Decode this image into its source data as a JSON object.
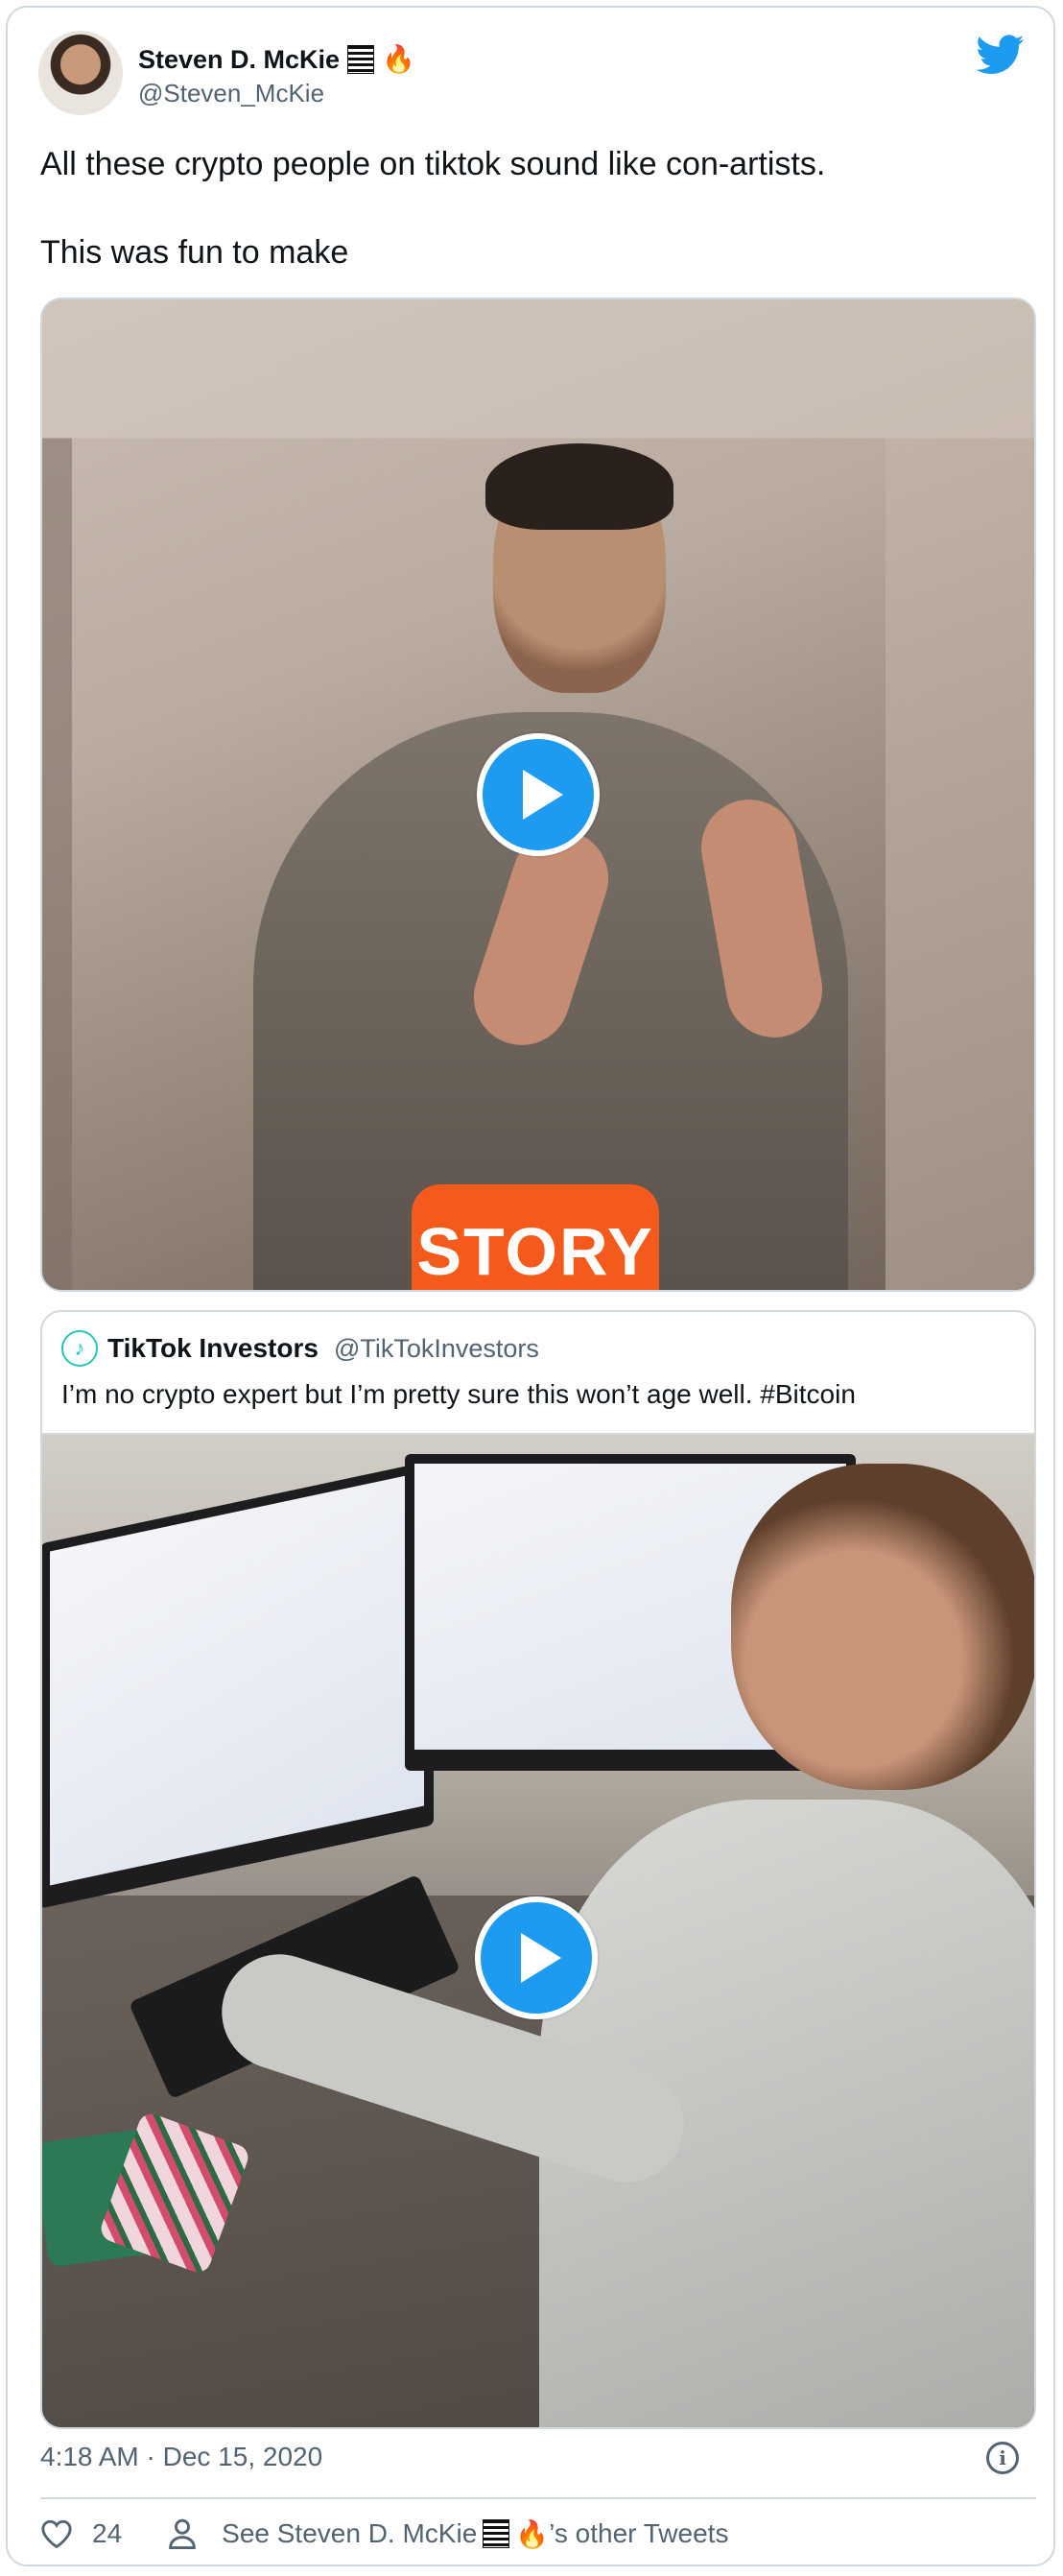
{
  "author": {
    "name": "Steven D. McKie",
    "handle": "@Steven_McKie",
    "name_emoji": "🔥"
  },
  "tweet": {
    "line1": "All these crypto people on tiktok sound like con-artists.",
    "line2": "This was fun to make"
  },
  "video1": {
    "sticker_text": "STORY"
  },
  "quoted": {
    "name": "TikTok Investors",
    "handle": "@TikTokInvestors",
    "text": "I’m no crypto expert but I’m pretty sure this won’t age well. #Bitcoin"
  },
  "footer": {
    "timestamp": "4:18 AM · Dec 15, 2020",
    "like_count": "24",
    "see_other_prefix": "See Steven D. McKie",
    "see_other_suffix": "’s other Tweets",
    "see_other_emoji": "🔥"
  },
  "colors": {
    "accent": "#1d9bf0",
    "secondary_text": "#536471",
    "border": "#cfd9de"
  },
  "icons": [
    "twitter-bird-icon",
    "play-icon",
    "info-icon",
    "heart-icon",
    "person-icon",
    "tiktok-icon"
  ]
}
